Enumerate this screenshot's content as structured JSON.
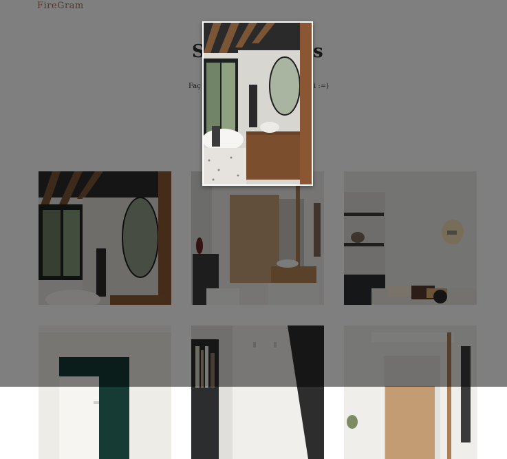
{
  "header": {
    "brand": "FireGram"
  },
  "main": {
    "title_left": "S",
    "title_right": "s",
    "subtitle_left": "Faç",
    "subtitle_right": "i :=)"
  },
  "gallery": {
    "images": [
      {
        "name": "bathroom-wood-beams"
      },
      {
        "name": "bathroom-vanity-wood-panel"
      },
      {
        "name": "living-room-shelves"
      },
      {
        "name": "room-white-door"
      },
      {
        "name": "hallway-bookshelf"
      },
      {
        "name": "bathroom-narrow"
      }
    ]
  },
  "modal": {
    "image": "bathroom-wood-beams"
  }
}
